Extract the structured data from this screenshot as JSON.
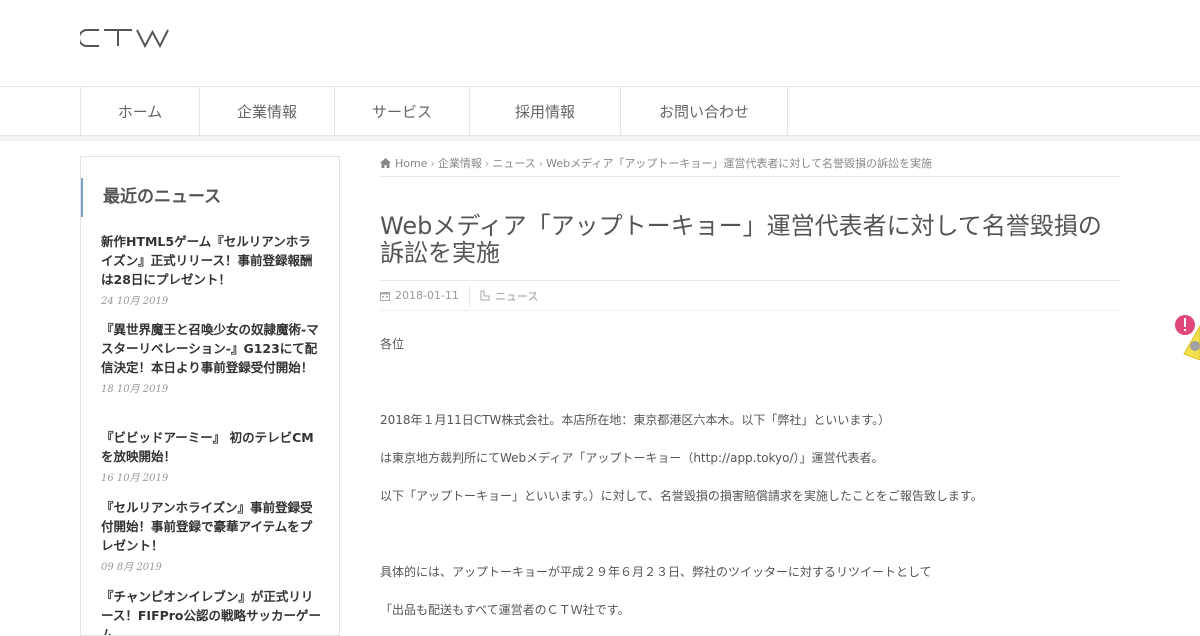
{
  "header": {
    "logo_text": "CTW"
  },
  "nav": {
    "items": [
      {
        "label": "ホーム"
      },
      {
        "label": "企業情報"
      },
      {
        "label": "サービス"
      },
      {
        "label": "採用情報"
      },
      {
        "label": "お問い合わせ"
      }
    ]
  },
  "sidebar": {
    "widget_title": "最近のニュース",
    "posts": [
      {
        "title": "新作HTML5ゲーム『セルリアンホライズン』正式リリース！事前登録報酬は28日にプレゼント！",
        "date": "24 10月 2019"
      },
      {
        "title": "『異世界魔王と召喚少女の奴隷魔術-マスターリベレーション-』G123にて配信決定！本日より事前登録受付開始！",
        "date": "18 10月 2019"
      },
      {
        "title": "『ビビッドアーミー』 初のテレビCMを放映開始！",
        "date": "16 10月 2019"
      },
      {
        "title": "『セルリアンホライズン』事前登録受付開始！事前登録で豪華アイテムをプレゼント！",
        "date": "09 8月 2019"
      },
      {
        "title": "『チャンピオンイレブン』が正式リリース！FIFPro公認の戦略サッカーゲーム",
        "date": ""
      }
    ]
  },
  "breadcrumb": {
    "home": "Home",
    "items": [
      "企業情報",
      "ニュース",
      "Webメディア「アップトーキョー」運営代表者に対して名誉毀損の訴訟を実施"
    ],
    "separator": "›"
  },
  "article": {
    "title": "Webメディア「アップトーキョー」運営代表者に対して名誉毀損の訴訟を実施",
    "date": "2018-01-11",
    "category": "ニュース",
    "paragraphs": [
      "各位",
      "2018年１月11日CTW株式会社。本店所在地：東京都港区六本木。以下「弊社」といいます。）",
      "は東京地方裁判所にてWebメディア「アップトーキョー（http://app.tokyo/）」運営代表者。",
      "以下「アップトーキョー」といいます。）に対して、名誉毀損の損害賠償請求を実施したことをご報告致します。",
      "具体的には、アップトーキョーが平成２９年６月２３日、弊社のツイッターに対するリツイートとして",
      "「出品も配送もすべて運営者のＣＴＷ社です。"
    ]
  },
  "colors": {
    "accent_border": "#7aa4c7",
    "badge_pink": "#e0457b",
    "badge_yellow": "#f4e04d"
  }
}
